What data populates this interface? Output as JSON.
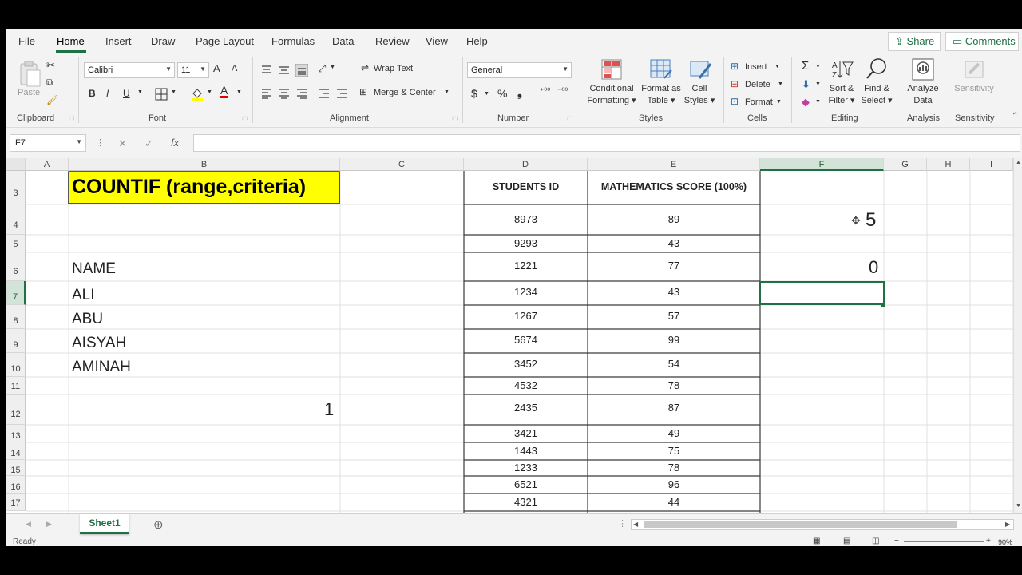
{
  "menu": {
    "tabs": [
      "File",
      "Home",
      "Insert",
      "Draw",
      "Page Layout",
      "Formulas",
      "Data",
      "Review",
      "View",
      "Help"
    ],
    "share": "Share",
    "comments": "Comments"
  },
  "ribbon": {
    "clipboard": {
      "paste": "Paste",
      "label": "Clipboard"
    },
    "font": {
      "name": "Calibri",
      "size": "11",
      "bold": "B",
      "italic": "I",
      "underline": "U",
      "label": "Font",
      "grow": "A",
      "shrink": "A",
      "font_color": "A"
    },
    "alignment": {
      "wrap_text": "Wrap Text",
      "merge_center": "Merge & Center",
      "label": "Alignment"
    },
    "number": {
      "format": "General",
      "currency": "$",
      "percent": "%",
      "comma": "❟",
      "label": "Number"
    },
    "styles": {
      "conditional_1": "Conditional",
      "conditional_2": "Formatting",
      "format_table_1": "Format as",
      "format_table_2": "Table",
      "cell_styles_1": "Cell",
      "cell_styles_2": "Styles",
      "label": "Styles"
    },
    "cells": {
      "insert": "Insert",
      "delete": "Delete",
      "format": "Format",
      "label": "Cells"
    },
    "editing": {
      "sum": "Σ",
      "sort_1": "Sort &",
      "sort_2": "Filter",
      "find_1": "Find &",
      "find_2": "Select",
      "label": "Editing"
    },
    "analysis": {
      "analyze_1": "Analyze",
      "analyze_2": "Data",
      "label": "Analysis"
    },
    "sensitivity": {
      "sens": "Sensitivity",
      "label": "Sensitivity"
    }
  },
  "formula_bar": {
    "name_box": "F7",
    "cancel": "✕",
    "enter": "✓",
    "fx": "fx",
    "value": ""
  },
  "columns": [
    "A",
    "B",
    "C",
    "D",
    "E",
    "F",
    "G",
    "H",
    "I"
  ],
  "rows": [
    "3",
    "4",
    "5",
    "6",
    "7",
    "8",
    "9",
    "10",
    "11",
    "12",
    "13",
    "14",
    "15",
    "16",
    "17"
  ],
  "cells": {
    "b3": "COUNTIF (range,criteria)",
    "b6": "NAME",
    "b7": "ALI",
    "b8": "ABU",
    "b9": "AISYAH",
    "b10": "AMINAH",
    "b12": "1",
    "f4": "5",
    "f6": "0"
  },
  "table": {
    "headers": [
      "STUDENTS ID",
      "MATHEMATICS SCORE (100%)"
    ],
    "rows": [
      [
        "8973",
        "89"
      ],
      [
        "9293",
        "43"
      ],
      [
        "1221",
        "77"
      ],
      [
        "1234",
        "43"
      ],
      [
        "1267",
        "57"
      ],
      [
        "5674",
        "99"
      ],
      [
        "3452",
        "54"
      ],
      [
        "4532",
        "78"
      ],
      [
        "2435",
        "87"
      ],
      [
        "3421",
        "49"
      ],
      [
        "1443",
        "75"
      ],
      [
        "1233",
        "78"
      ],
      [
        "6521",
        "96"
      ],
      [
        "4321",
        "44"
      ]
    ]
  },
  "sheet_tabs": [
    "Sheet1"
  ],
  "status": {
    "ready": "Ready",
    "zoom": "90%"
  },
  "colors": {
    "accent": "#1e7145",
    "highlight": "#ffff00"
  }
}
